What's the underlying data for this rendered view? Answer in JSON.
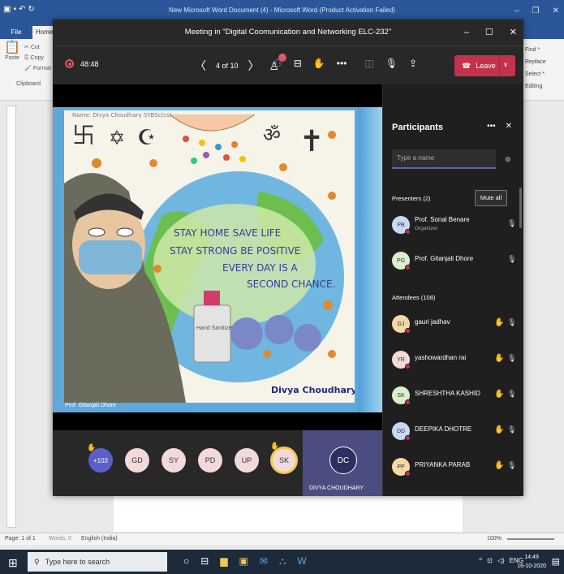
{
  "word": {
    "title": "New Microsoft Word Document (4) - Microsoft Word (Product Activation Failed)",
    "file_tab": "File",
    "home_tab": "Home",
    "ribbon_left": [
      "Cut",
      "Copy",
      "Format",
      "Paste",
      "Clipboard"
    ],
    "ribbon_right": [
      "Find *",
      "Replace",
      "Select *",
      "Editing"
    ],
    "status": {
      "page": "Page: 1 of 1",
      "words": "Words: 0",
      "language": "English (India)",
      "zoom": "100%"
    }
  },
  "taskbar": {
    "search_placeholder": "Type here to search",
    "time": "14:49",
    "date": "16-10-2020",
    "lang": "ENG"
  },
  "teams": {
    "title": "Meeting in \"Digital Coomunication and Networking ELC-232\"",
    "timer": "48:48",
    "page_indicator": "4 of 10",
    "participant_badge": "5",
    "leave_label": "Leave",
    "presenter_label": "Prof. Gitanjali Dhore",
    "drawing": {
      "name_line": "Name: Divya Choudhary   SYBSc(cs)",
      "lines": [
        "STAY HOME SAVE LIFE",
        "STAY STRONG BE POSITIVE",
        "EVERY DAY IS A",
        "SECOND CHANCE."
      ],
      "signature": "Divya Choudhary",
      "bottle_label": "Hand Sanitizer"
    },
    "strip": {
      "more": "+103",
      "avatars": [
        "GD",
        "SY",
        "PD",
        "UP",
        "SK"
      ],
      "tile_initials": "DC",
      "tile_name": "DIVYA CHOUDHARY"
    },
    "panel": {
      "heading": "Participants",
      "search_placeholder": "Type a name",
      "presenters_label": "Presenters (2)",
      "mute_all": "Mute all",
      "attendees_label": "Attendees (108)",
      "presenters": [
        {
          "initials": "PB",
          "name": "Prof. Sonal Benare",
          "role": "Organizer",
          "color": "#c7d9f4"
        },
        {
          "initials": "PG",
          "name": "Prof. Gitanjali Dhore",
          "role": "",
          "color": "#d9f0cc"
        }
      ],
      "attendees": [
        {
          "initials": "GJ",
          "name": "gauri jadhav",
          "color": "#f6d7a7"
        },
        {
          "initials": "YR",
          "name": "yashowardhan rai",
          "color": "#f3dada"
        },
        {
          "initials": "SK",
          "name": "SHRESHTHA KASHID",
          "color": "#d9f0cc"
        },
        {
          "initials": "DD",
          "name": "DEEPIKA DHOTRE",
          "color": "#c7d9f4"
        },
        {
          "initials": "PP",
          "name": "PRIYANKA PARAB",
          "color": "#f6d7a7"
        }
      ]
    }
  }
}
